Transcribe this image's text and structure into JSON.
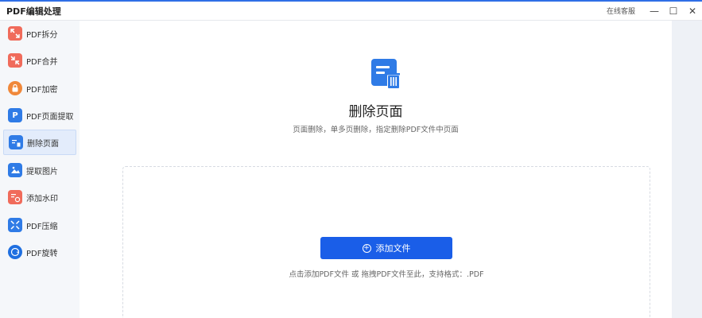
{
  "app": {
    "title": "PDF编辑处理",
    "service": "在线客服",
    "minimize": "—",
    "maximize": "☐",
    "close": "✕"
  },
  "sidebar": {
    "items": [
      {
        "label": "PDF拆分",
        "icon": "split-icon",
        "color": "#f06b5b"
      },
      {
        "label": "PDF合并",
        "icon": "merge-icon",
        "color": "#f06b5b"
      },
      {
        "label": "PDF加密",
        "icon": "lock-icon",
        "color": "#f0883a"
      },
      {
        "label": "PDF页面提取",
        "icon": "page-extract-icon",
        "color": "#2f7be6"
      },
      {
        "label": "删除页面",
        "icon": "delete-page-icon",
        "color": "#2f7be6"
      },
      {
        "label": "提取图片",
        "icon": "extract-image-icon",
        "color": "#2f7be6"
      },
      {
        "label": "添加水印",
        "icon": "watermark-icon",
        "color": "#f06b5b"
      },
      {
        "label": "PDF压缩",
        "icon": "compress-icon",
        "color": "#2f7be6"
      },
      {
        "label": "PDF旋转",
        "icon": "rotate-icon",
        "color": "#1f6fe0"
      }
    ],
    "active_index": 4
  },
  "main": {
    "title": "删除页面",
    "subtitle": "页面删除，单多页删除，指定删除PDF文件中页面",
    "add_button": "添加文件",
    "hint": "点击添加PDF文件 或 拖拽PDF文件至此，支持格式：.PDF"
  },
  "colors": {
    "accent": "#1a5ee8",
    "title_bar_line": "#2f6fe6",
    "active_bg": "#e3ecfb"
  }
}
